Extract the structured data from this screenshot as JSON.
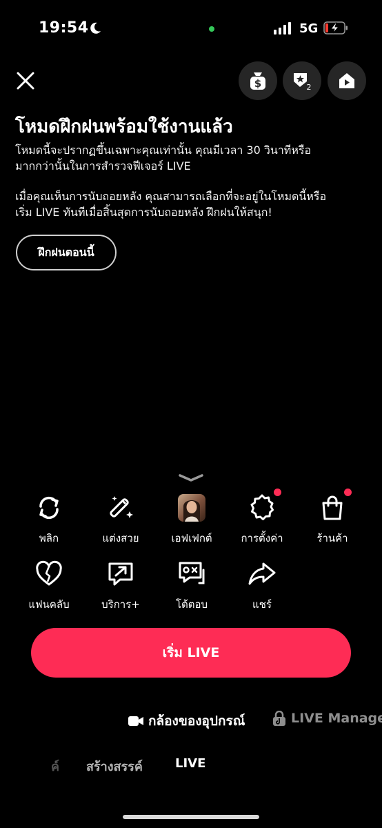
{
  "status_bar": {
    "time": "19:54",
    "network": "5G"
  },
  "header": {
    "close_icon": "close-icon",
    "buttons": [
      {
        "name": "coin-bag-button",
        "icon": "dollar-bag-icon"
      },
      {
        "name": "rank-button",
        "icon": "rank-shield-icon",
        "badge": "2"
      },
      {
        "name": "home-play-button",
        "icon": "home-play-icon"
      }
    ]
  },
  "intro": {
    "title": "โหมดฝึกฝนพร้อมใช้งานแล้ว",
    "line1": "โหมดนี้จะปรากฏขึ้นเฉพาะคุณเท่านั้น คุณมีเวลา 30 วินาทีหรือ",
    "line2": "มากกว่านั้นในการสำรวจฟีเจอร์ LIVE",
    "line3": "เมื่อคุณเห็นการนับถอยหลัง คุณสามารถเลือกที่จะอยู่ในโหมดนี้หรือ",
    "line4": "เริ่ม LIVE ทันทีเมื่อสิ้นสุดการนับถอยหลัง ฝึกฝนให้สนุก!",
    "practice_button": "ฝึกฝนตอนนี้"
  },
  "tools": {
    "row1": [
      "พลิก",
      "แต่งสวย",
      "เอฟเฟกต์",
      "การตั้งค่า",
      "ร้านค้า"
    ],
    "row2": [
      "แฟนคลับ",
      "บริการ+",
      "โต้ตอบ",
      "แชร์"
    ]
  },
  "go_live_button": "เริ่ม LIVE",
  "source": {
    "camera_label": "กล้องของอุปกรณ์",
    "live_manager_label": "LIVE Manage"
  },
  "mode_tabs": {
    "partial": "ค์",
    "create": "สร้างสรรค์",
    "live": "LIVE"
  },
  "colors": {
    "accent": "#fe2c55",
    "background": "#000000",
    "chip": "#262626"
  }
}
